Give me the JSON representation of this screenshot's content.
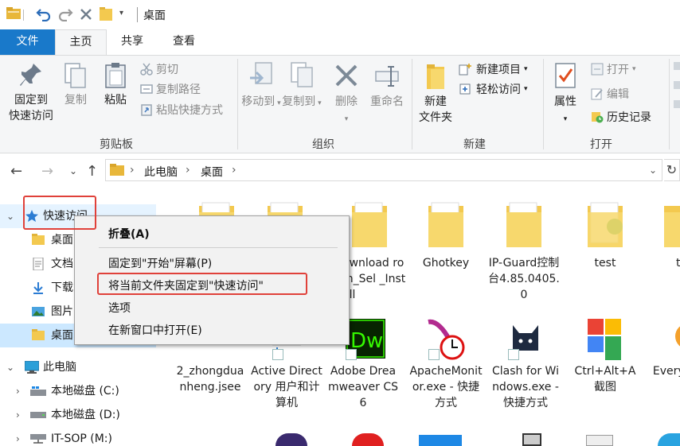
{
  "window": {
    "title": "桌面",
    "quick_access_toolbar": [
      "folder-icon",
      "undo-icon",
      "redo-icon",
      "delete-icon",
      "new-folder-icon",
      "customize-dropdown-icon"
    ]
  },
  "ribbon_tabs": {
    "file": "文件",
    "home": "主页",
    "share": "共享",
    "view": "查看"
  },
  "ribbon": {
    "clipboard": {
      "label": "剪贴板",
      "pin_line1": "固定到",
      "pin_line2": "快速访问",
      "copy": "复制",
      "paste": "粘贴",
      "cut": "剪切",
      "copy_path": "复制路径",
      "paste_shortcut": "粘贴快捷方式"
    },
    "organize": {
      "label": "组织",
      "move_to": "移动到",
      "copy_to": "复制到",
      "delete": "删除",
      "rename": "重命名"
    },
    "new": {
      "label": "新建",
      "new_folder_line1": "新建",
      "new_folder_line2": "文件夹",
      "new_item": "新建项目",
      "easy_access": "轻松访问"
    },
    "open": {
      "label": "打开",
      "properties": "属性",
      "open": "打开",
      "edit": "编辑",
      "history": "历史记录"
    }
  },
  "address_bar": {
    "crumbs": [
      "此电脑",
      "桌面"
    ],
    "separator": "›"
  },
  "nav_pane": {
    "quick_access": "快速访问",
    "items": [
      {
        "label": "桌面"
      },
      {
        "label": "文档"
      },
      {
        "label": "下载"
      },
      {
        "label": "图片"
      },
      {
        "label": "桌面"
      }
    ],
    "this_pc": "此电脑",
    "drives": [
      {
        "label": "本地磁盘 (C:)"
      },
      {
        "label": "本地磁盘 (D:)"
      },
      {
        "label": "IT-SOP (M:)"
      }
    ]
  },
  "files_row1": [
    {
      "name": ""
    },
    {
      "name": ""
    },
    {
      "name": "ownload_Sel\n_Install",
      "display": "ownload rom_Sel _Install"
    },
    {
      "name": "Ghotkey"
    },
    {
      "name": "IP-Guard控制台4.85.0405.0"
    },
    {
      "name": "test"
    },
    {
      "name": "te"
    }
  ],
  "files_row2": [
    {
      "name": "2_zhongduanheng.jsee"
    },
    {
      "name": "Active Directory 用户和计算机"
    },
    {
      "name": "Adobe Dreamweaver CS6"
    },
    {
      "name": "ApacheMonitor.exe - 快捷方式"
    },
    {
      "name": "Clash for Windows.exe - 快捷方式"
    },
    {
      "name": "Ctrl+Alt+A 截图"
    },
    {
      "name": "Every 超级"
    }
  ],
  "context_menu": {
    "collapse": "折叠(A)",
    "pin_start": "固定到\"开始\"屏幕(P)",
    "pin_quick_access": "将当前文件夹固定到\"快速访问\"",
    "options": "选项",
    "open_new_window": "在新窗口中打开(E)"
  },
  "colors": {
    "accent": "#1979ca",
    "selection": "#cce8ff",
    "highlight_box": "#e0413a",
    "folder": "#f3c94f"
  }
}
